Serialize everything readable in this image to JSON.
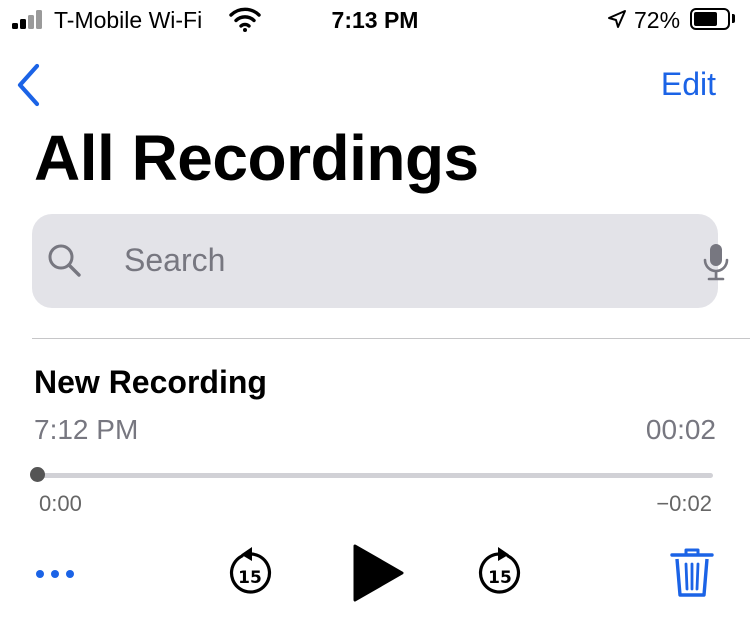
{
  "status_bar": {
    "carrier": "T-Mobile Wi-Fi",
    "time": "7:13 PM",
    "battery": "72%",
    "battery_level": 0.72
  },
  "nav": {
    "back_icon": "chevron-left-icon",
    "edit_label": "Edit"
  },
  "page_title": "All Recordings",
  "search": {
    "placeholder": "Search",
    "value": ""
  },
  "recording": {
    "title": "New Recording",
    "time": "7:12 PM",
    "duration": "00:02",
    "elapsed": "0:00",
    "remaining": "−0:02",
    "progress": 0
  },
  "controls": {
    "skip_back_label": "15",
    "skip_forward_label": "15",
    "icons": [
      "more-icon",
      "skip-back-15-icon",
      "play-icon",
      "skip-forward-15-icon",
      "trash-icon"
    ]
  },
  "colors": {
    "accent": "#1b63e6",
    "search_bg": "#e3e3e8",
    "secondary_text": "#777780"
  }
}
